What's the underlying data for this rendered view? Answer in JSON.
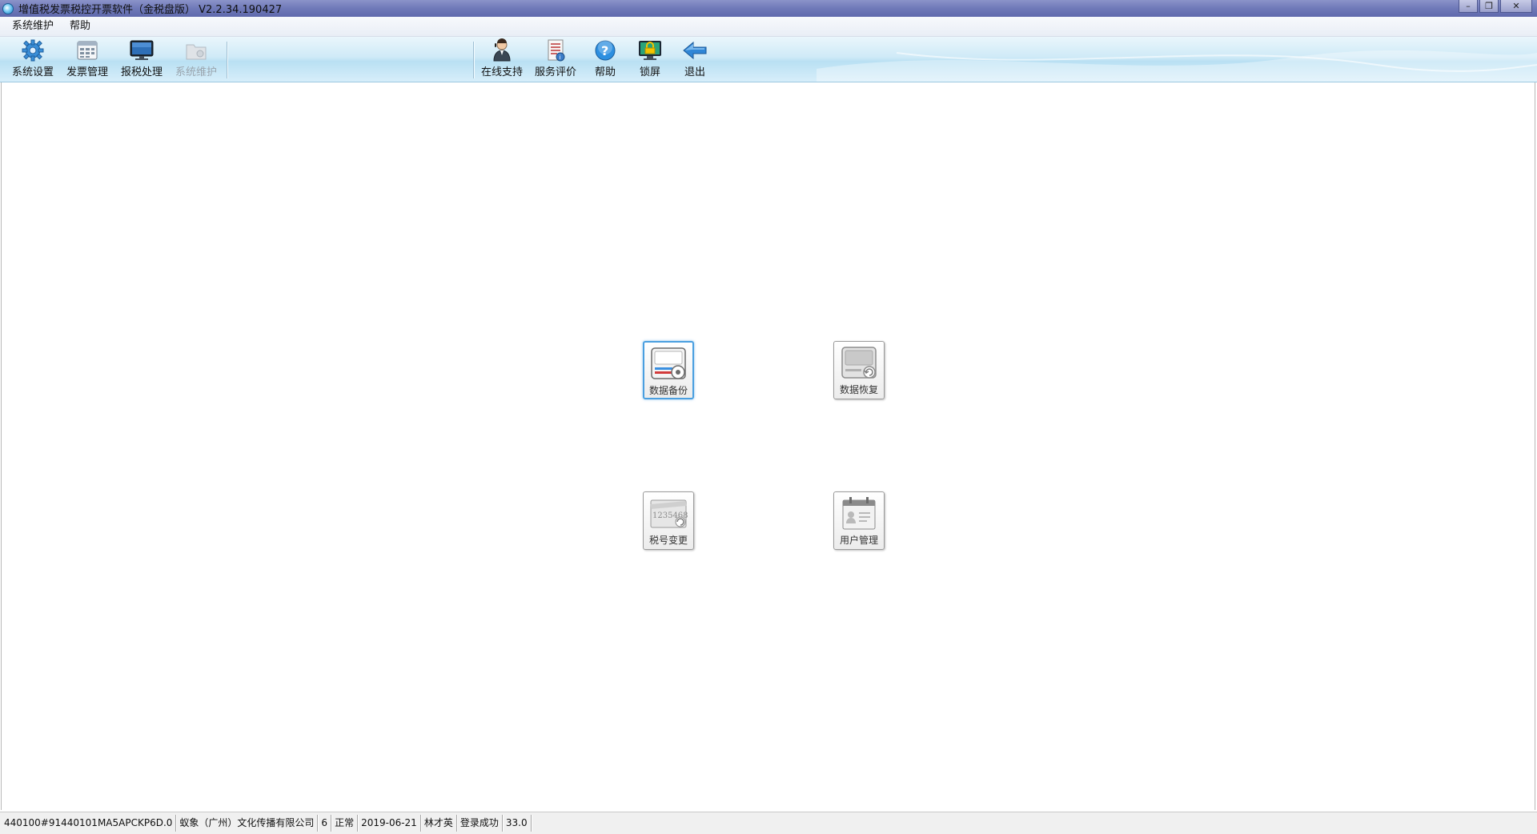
{
  "window": {
    "title": "增值税发票税控开票软件（金税盘版） V2.2.34.190427",
    "controls": {
      "minimize": "–",
      "restore": "❐",
      "close": "✕"
    }
  },
  "menubar": {
    "items": [
      {
        "label": "系统维护"
      },
      {
        "label": "帮助"
      }
    ]
  },
  "toolbar": {
    "left": [
      {
        "label": "系统设置",
        "icon": "gear-icon",
        "disabled": false
      },
      {
        "label": "发票管理",
        "icon": "invoice-icon",
        "disabled": false
      },
      {
        "label": "报税处理",
        "icon": "monitor-icon",
        "disabled": false
      },
      {
        "label": "系统维护",
        "icon": "maintenance-icon",
        "disabled": true
      }
    ],
    "right": [
      {
        "label": "在线支持",
        "icon": "support-person-icon"
      },
      {
        "label": "服务评价",
        "icon": "evaluation-icon"
      },
      {
        "label": "帮助",
        "icon": "help-icon"
      },
      {
        "label": "锁屏",
        "icon": "lock-screen-icon"
      },
      {
        "label": "退出",
        "icon": "exit-arrow-icon"
      }
    ]
  },
  "functions": [
    {
      "label": "数据备份",
      "icon": "data-backup-icon",
      "selected": true
    },
    {
      "label": "数据恢复",
      "icon": "data-restore-icon",
      "selected": false
    },
    {
      "label": "税号变更",
      "icon": "tax-number-change-icon",
      "selected": false,
      "icon_text": "1235468"
    },
    {
      "label": "用户管理",
      "icon": "user-management-icon",
      "selected": false
    }
  ],
  "statusbar": {
    "cells": [
      "440100#91440101MA5APCKP6D.0",
      "蚁象（广州）文化传播有限公司",
      "6",
      "正常",
      "2019-06-21",
      "林才英",
      "登录成功",
      "33.0"
    ]
  },
  "colors": {
    "titlebar": "#6f79b8",
    "toolbar": "#cfeaf7",
    "selection_border": "#4a9fe0"
  }
}
